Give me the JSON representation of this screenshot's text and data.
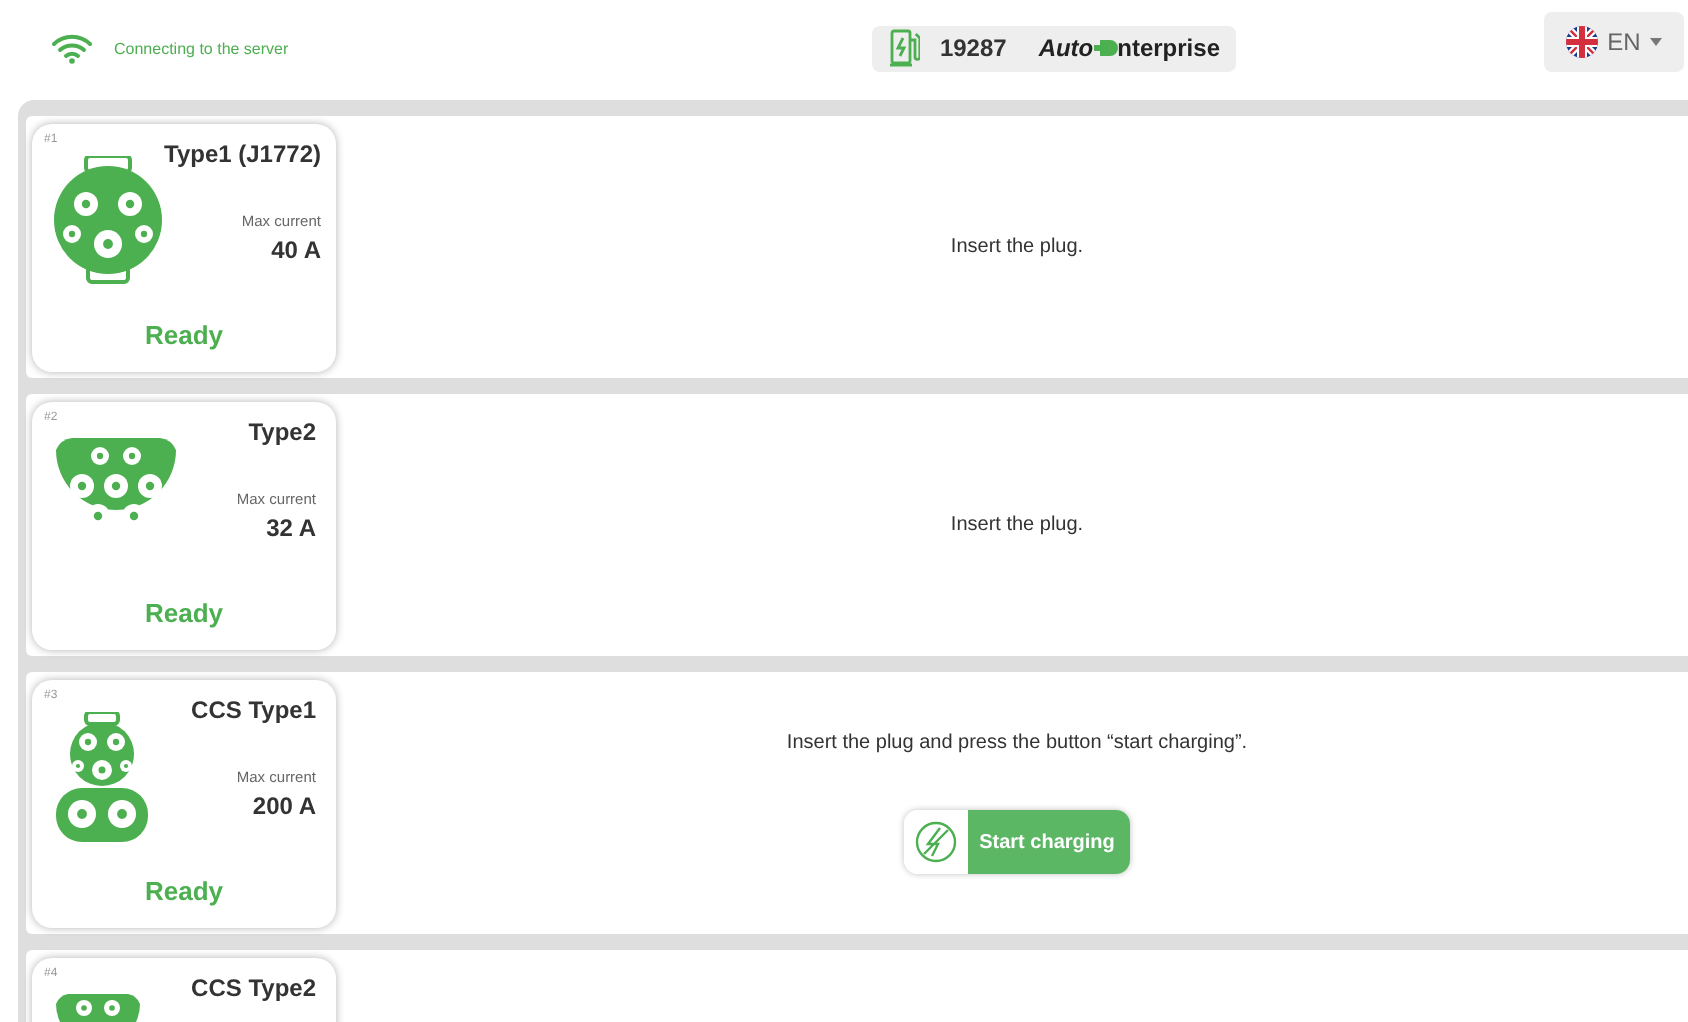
{
  "header": {
    "connection": "Connecting to the server",
    "station_id": "19287",
    "brand_prefix": "Auto",
    "brand_suffix": "nterprise",
    "language": "EN"
  },
  "connectors": [
    {
      "number": "#1",
      "kind": "type1",
      "name": "Type1 (J1772)",
      "current_label": "Max current",
      "current": "40 A",
      "status": "Ready",
      "message": "Insert the plug."
    },
    {
      "number": "#2",
      "kind": "type2",
      "name": "Type2",
      "current_label": "Max current",
      "current": "32 A",
      "status": "Ready",
      "message": "Insert the plug."
    },
    {
      "number": "#3",
      "kind": "ccs1",
      "name": "CCS Type1",
      "current_label": "Max current",
      "current": "200 A",
      "status": "Ready",
      "message": "Insert the plug and press the button “start charging”.",
      "action": "Start charging"
    },
    {
      "number": "#4",
      "kind": "ccs2",
      "name": "CCS Type2"
    }
  ]
}
